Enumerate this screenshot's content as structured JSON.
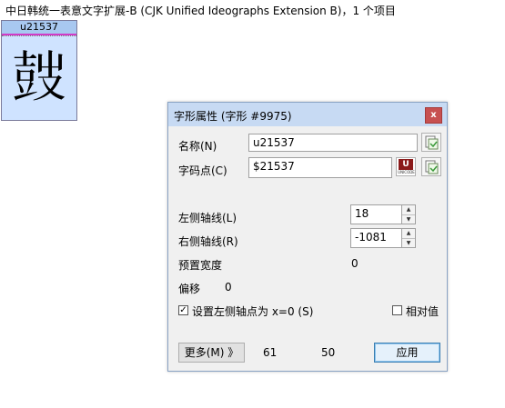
{
  "header": {
    "text": "中日韩统一表意文字扩展-B (CJK Unified Ideographs Extension B)，1 个项目"
  },
  "glyph_cell": {
    "label": "u21537",
    "glyph": "𡔷"
  },
  "dialog": {
    "title": "字形属性 (字形 #9975)",
    "close_label": "x",
    "name_label": "名称(N)",
    "name_value": "u21537",
    "codepoint_label": "字码点(C)",
    "codepoint_value": "$21537",
    "unicode_icon_text": "U",
    "unicode_icon_caption": "UNICODE",
    "left_bearing_label": "左侧轴线(L)",
    "left_bearing_value": "18",
    "right_bearing_label": "右侧轴线(R)",
    "right_bearing_value": "-1081",
    "preset_width_label": "预置宽度",
    "preset_width_value": "0",
    "offset_label": "偏移",
    "offset_value": "0",
    "set_left_label": "设置左侧轴点为 x=0 (S)",
    "set_left_checked": true,
    "relative_label": "相对值",
    "relative_checked": false,
    "more_button": "更多(M) 》",
    "stat_a": "61",
    "stat_b": "50",
    "apply_button": "应用"
  }
}
